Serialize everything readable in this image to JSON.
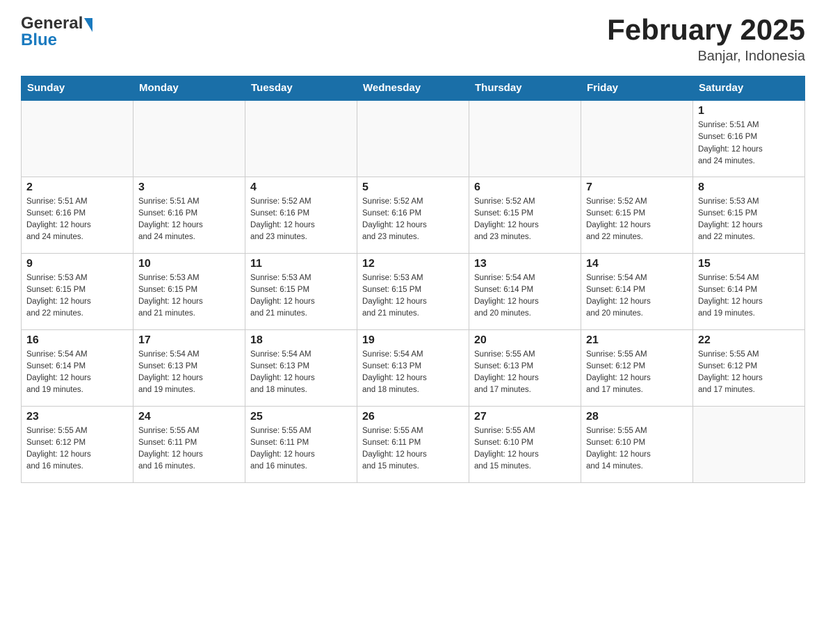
{
  "header": {
    "logo_general": "General",
    "logo_blue": "Blue",
    "title": "February 2025",
    "subtitle": "Banjar, Indonesia"
  },
  "days_of_week": [
    "Sunday",
    "Monday",
    "Tuesday",
    "Wednesday",
    "Thursday",
    "Friday",
    "Saturday"
  ],
  "weeks": [
    [
      {
        "day": "",
        "info": ""
      },
      {
        "day": "",
        "info": ""
      },
      {
        "day": "",
        "info": ""
      },
      {
        "day": "",
        "info": ""
      },
      {
        "day": "",
        "info": ""
      },
      {
        "day": "",
        "info": ""
      },
      {
        "day": "1",
        "info": "Sunrise: 5:51 AM\nSunset: 6:16 PM\nDaylight: 12 hours\nand 24 minutes."
      }
    ],
    [
      {
        "day": "2",
        "info": "Sunrise: 5:51 AM\nSunset: 6:16 PM\nDaylight: 12 hours\nand 24 minutes."
      },
      {
        "day": "3",
        "info": "Sunrise: 5:51 AM\nSunset: 6:16 PM\nDaylight: 12 hours\nand 24 minutes."
      },
      {
        "day": "4",
        "info": "Sunrise: 5:52 AM\nSunset: 6:16 PM\nDaylight: 12 hours\nand 23 minutes."
      },
      {
        "day": "5",
        "info": "Sunrise: 5:52 AM\nSunset: 6:16 PM\nDaylight: 12 hours\nand 23 minutes."
      },
      {
        "day": "6",
        "info": "Sunrise: 5:52 AM\nSunset: 6:15 PM\nDaylight: 12 hours\nand 23 minutes."
      },
      {
        "day": "7",
        "info": "Sunrise: 5:52 AM\nSunset: 6:15 PM\nDaylight: 12 hours\nand 22 minutes."
      },
      {
        "day": "8",
        "info": "Sunrise: 5:53 AM\nSunset: 6:15 PM\nDaylight: 12 hours\nand 22 minutes."
      }
    ],
    [
      {
        "day": "9",
        "info": "Sunrise: 5:53 AM\nSunset: 6:15 PM\nDaylight: 12 hours\nand 22 minutes."
      },
      {
        "day": "10",
        "info": "Sunrise: 5:53 AM\nSunset: 6:15 PM\nDaylight: 12 hours\nand 21 minutes."
      },
      {
        "day": "11",
        "info": "Sunrise: 5:53 AM\nSunset: 6:15 PM\nDaylight: 12 hours\nand 21 minutes."
      },
      {
        "day": "12",
        "info": "Sunrise: 5:53 AM\nSunset: 6:15 PM\nDaylight: 12 hours\nand 21 minutes."
      },
      {
        "day": "13",
        "info": "Sunrise: 5:54 AM\nSunset: 6:14 PM\nDaylight: 12 hours\nand 20 minutes."
      },
      {
        "day": "14",
        "info": "Sunrise: 5:54 AM\nSunset: 6:14 PM\nDaylight: 12 hours\nand 20 minutes."
      },
      {
        "day": "15",
        "info": "Sunrise: 5:54 AM\nSunset: 6:14 PM\nDaylight: 12 hours\nand 19 minutes."
      }
    ],
    [
      {
        "day": "16",
        "info": "Sunrise: 5:54 AM\nSunset: 6:14 PM\nDaylight: 12 hours\nand 19 minutes."
      },
      {
        "day": "17",
        "info": "Sunrise: 5:54 AM\nSunset: 6:13 PM\nDaylight: 12 hours\nand 19 minutes."
      },
      {
        "day": "18",
        "info": "Sunrise: 5:54 AM\nSunset: 6:13 PM\nDaylight: 12 hours\nand 18 minutes."
      },
      {
        "day": "19",
        "info": "Sunrise: 5:54 AM\nSunset: 6:13 PM\nDaylight: 12 hours\nand 18 minutes."
      },
      {
        "day": "20",
        "info": "Sunrise: 5:55 AM\nSunset: 6:13 PM\nDaylight: 12 hours\nand 17 minutes."
      },
      {
        "day": "21",
        "info": "Sunrise: 5:55 AM\nSunset: 6:12 PM\nDaylight: 12 hours\nand 17 minutes."
      },
      {
        "day": "22",
        "info": "Sunrise: 5:55 AM\nSunset: 6:12 PM\nDaylight: 12 hours\nand 17 minutes."
      }
    ],
    [
      {
        "day": "23",
        "info": "Sunrise: 5:55 AM\nSunset: 6:12 PM\nDaylight: 12 hours\nand 16 minutes."
      },
      {
        "day": "24",
        "info": "Sunrise: 5:55 AM\nSunset: 6:11 PM\nDaylight: 12 hours\nand 16 minutes."
      },
      {
        "day": "25",
        "info": "Sunrise: 5:55 AM\nSunset: 6:11 PM\nDaylight: 12 hours\nand 16 minutes."
      },
      {
        "day": "26",
        "info": "Sunrise: 5:55 AM\nSunset: 6:11 PM\nDaylight: 12 hours\nand 15 minutes."
      },
      {
        "day": "27",
        "info": "Sunrise: 5:55 AM\nSunset: 6:10 PM\nDaylight: 12 hours\nand 15 minutes."
      },
      {
        "day": "28",
        "info": "Sunrise: 5:55 AM\nSunset: 6:10 PM\nDaylight: 12 hours\nand 14 minutes."
      },
      {
        "day": "",
        "info": ""
      }
    ]
  ]
}
